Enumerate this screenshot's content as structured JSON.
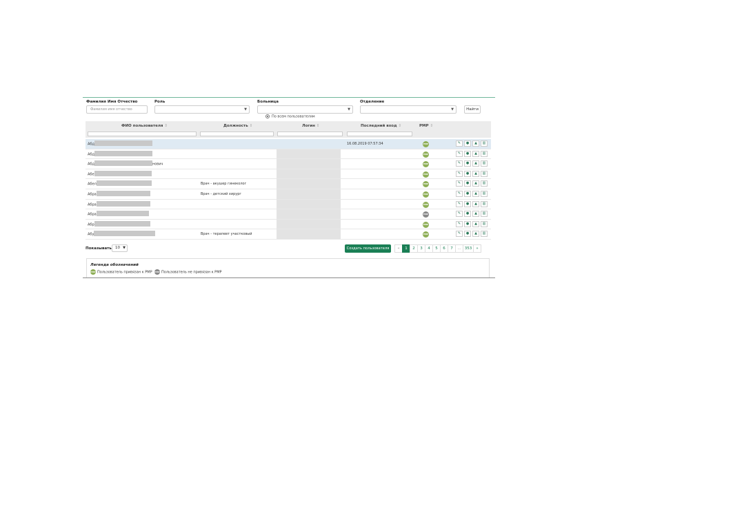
{
  "filters": {
    "fio_label": "Фамилия Имя Отчество",
    "fio_placeholder": "Фамилия имя отчество",
    "role_label": "Роль",
    "role_value": "",
    "hospital_label": "Больница",
    "hospital_value": "",
    "department_label": "Отделение",
    "department_value": "",
    "find_button": "Найти",
    "radio_all_users": "По всем пользователям"
  },
  "table": {
    "columns": [
      "ФИО пользователя",
      "Должность",
      "Логин",
      "Последний вход",
      "РМР"
    ],
    "sort_icon": "⇕",
    "rows": [
      {
        "name": "Абд",
        "name_suffix": "",
        "position": "",
        "last_login": "16.08.2019 07:57:34",
        "rmp": "РМР",
        "rmp_linked": true
      },
      {
        "name": "Абд",
        "name_suffix": "",
        "position": "",
        "last_login": "",
        "rmp": "РМР",
        "rmp_linked": true
      },
      {
        "name": "Абд",
        "name_suffix": "нович",
        "position": "",
        "last_login": "",
        "rmp": "РМР",
        "rmp_linked": true
      },
      {
        "name": "Абе",
        "name_suffix": "",
        "position": "",
        "last_login": "",
        "rmp": "РМР",
        "rmp_linked": true
      },
      {
        "name": "Абел",
        "name_suffix": "",
        "position": "Врач - акушер гинеколог",
        "last_login": "",
        "rmp": "РМР",
        "rmp_linked": true
      },
      {
        "name": "Абра",
        "name_suffix": "",
        "position": "Врач - детский хирург",
        "last_login": "",
        "rmp": "РМР",
        "rmp_linked": true
      },
      {
        "name": "Абра",
        "name_suffix": "",
        "position": "",
        "last_login": "",
        "rmp": "РМР",
        "rmp_linked": true
      },
      {
        "name": "Абра",
        "name_suffix": "",
        "position": "",
        "last_login": "",
        "rmp": "РМР",
        "rmp_linked": false
      },
      {
        "name": "Абр",
        "name_suffix": "",
        "position": "",
        "last_login": "",
        "rmp": "РМР",
        "rmp_linked": true
      },
      {
        "name": "Абу",
        "name_suffix": "",
        "position": "Врач - терапевт участковый",
        "last_login": "",
        "rmp": "РМР",
        "rmp_linked": true
      }
    ],
    "actions": [
      {
        "icon": "pencil-icon",
        "glyph": "✎"
      },
      {
        "icon": "eye-icon",
        "glyph": "●"
      },
      {
        "icon": "lock-icon",
        "glyph": "▲"
      },
      {
        "icon": "trash-icon",
        "glyph": "▥"
      }
    ]
  },
  "footer": {
    "show_label": "Показывать",
    "page_size": "10",
    "create_button": "Создать пользователя",
    "pagination": [
      "«",
      "1",
      "2",
      "3",
      "4",
      "5",
      "6",
      "7",
      "...",
      "353",
      "»"
    ],
    "current_page": "1"
  },
  "legend": {
    "title": "Легенда обозначений",
    "linked": "Пользователь привязан к РМР",
    "not_linked": "Пользователь не привязан к РМР",
    "badge": "РМР"
  },
  "colors": {
    "accent": "#1a7f55",
    "rmp_linked": "#8eae56",
    "rmp_not_linked": "#888888",
    "selected_row": "#dfeaf3"
  }
}
